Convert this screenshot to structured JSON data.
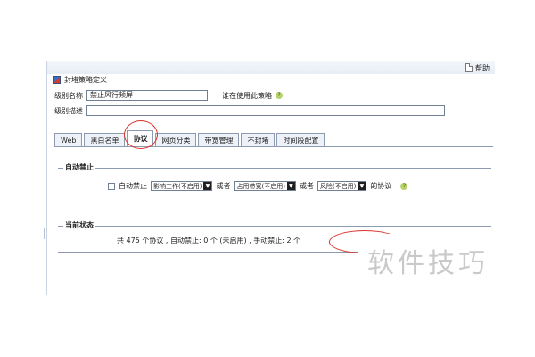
{
  "window": {
    "help_label": "帮助",
    "title": "封堵策略定义"
  },
  "form": {
    "level_name_label": "级别名称",
    "level_name_value": "禁止风行频屏",
    "who_uses_label": "谁在使用此策略",
    "level_desc_label": "级别描述",
    "level_desc_value": ""
  },
  "tabs": [
    {
      "label": "Web"
    },
    {
      "label": "黑白名单"
    },
    {
      "label": "协议"
    },
    {
      "label": "网页分类"
    },
    {
      "label": "带宽管理"
    },
    {
      "label": "不封堵"
    },
    {
      "label": "时间段配置"
    }
  ],
  "auto_block": {
    "title": "自动禁止",
    "checkbox_label": "自动禁止",
    "select1": "影响工作(不启用)",
    "or1": "或者",
    "select2": "占用带宽(不启用)",
    "or2": "或者",
    "select3": "风险(不启用)",
    "suffix": "的协议"
  },
  "status": {
    "title": "当前状态",
    "text": "共 475 个协议 , 自动禁止: 0 个 (未启用) , 手动禁止: 2 个"
  },
  "watermark": "软件技巧",
  "colors": {
    "annotation_circle": "#d9342b",
    "tab_border": "#8c9bb0"
  }
}
